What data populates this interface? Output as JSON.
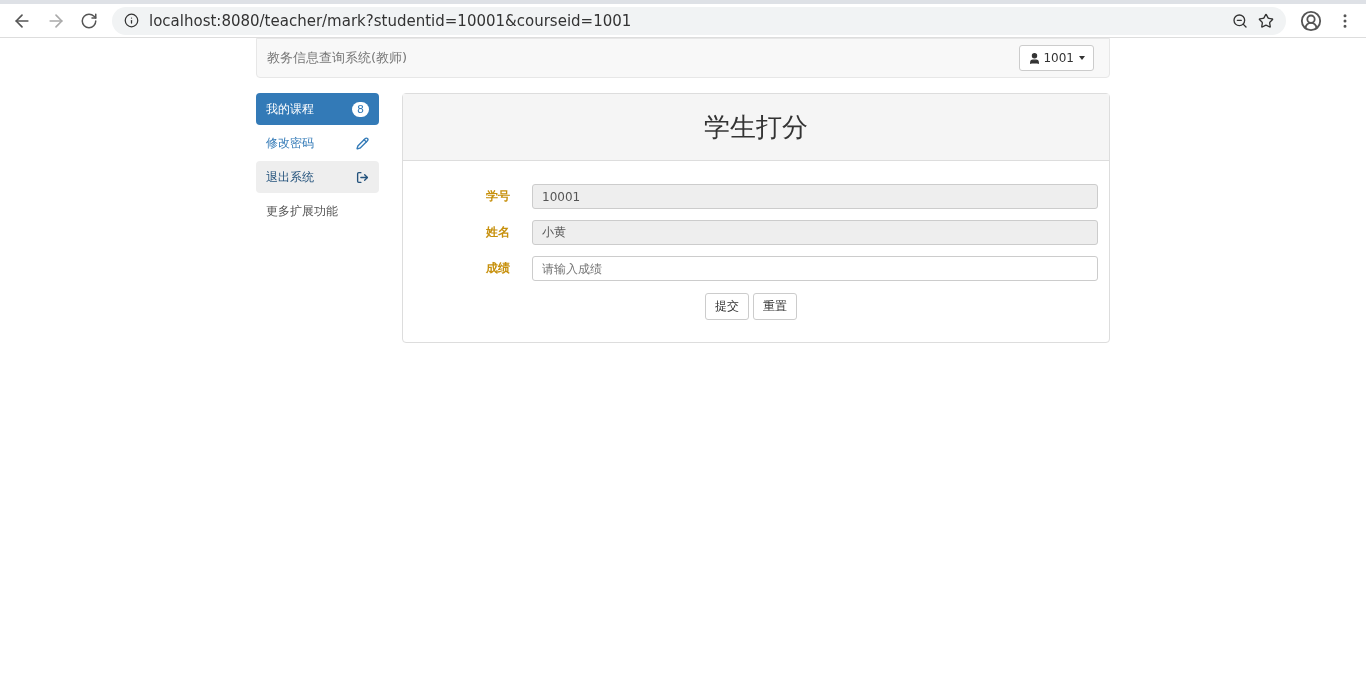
{
  "browser": {
    "url": "localhost:8080/teacher/mark?studentid=10001&courseid=1001"
  },
  "navbar": {
    "brand": "教务信息查询系统(教师)",
    "user": "1001"
  },
  "sidebar": {
    "items": [
      {
        "kind": "badge",
        "label": "我的课程",
        "selected": true,
        "hovered": false,
        "badge": "8"
      },
      {
        "kind": "edit",
        "label": "修改密码",
        "selected": false,
        "hovered": false
      },
      {
        "kind": "exit",
        "label": "退出系统",
        "selected": false,
        "hovered": true
      },
      {
        "kind": "plain",
        "label": "更多扩展功能",
        "selected": false,
        "hovered": false
      }
    ]
  },
  "panel": {
    "title": "学生打分",
    "fields": [
      {
        "label": "学号",
        "value": "10001",
        "readonly": true
      },
      {
        "label": "姓名",
        "value": "小黄",
        "readonly": true
      },
      {
        "label": "成绩",
        "placeholder": "请输入成绩",
        "readonly": false
      }
    ],
    "buttons": [
      "提交",
      "重置"
    ]
  }
}
